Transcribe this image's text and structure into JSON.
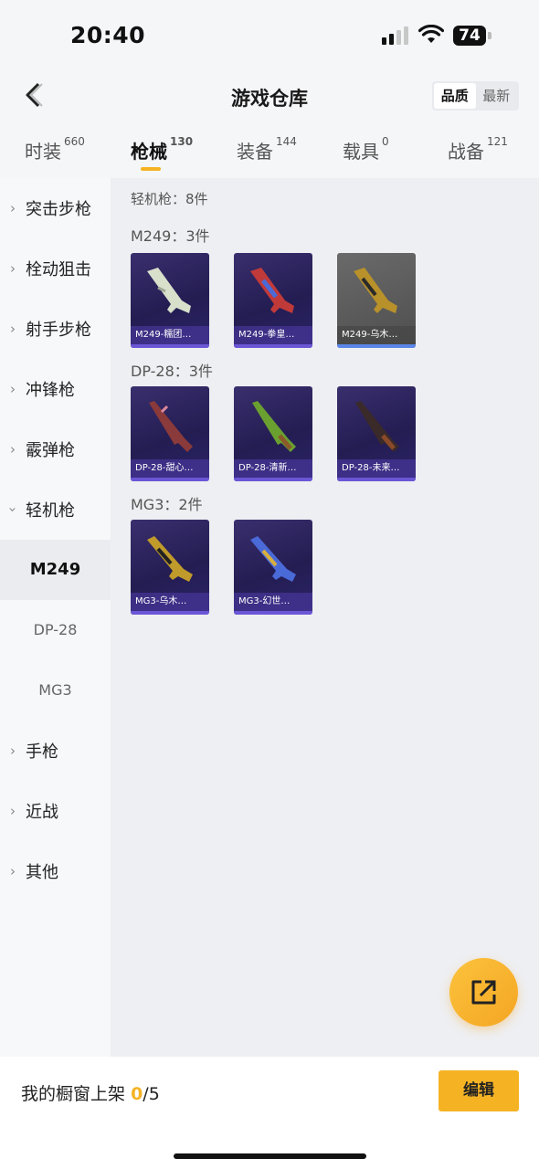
{
  "status": {
    "time": "20:40",
    "battery": "74"
  },
  "nav": {
    "title": "游戏仓库",
    "sort_options": [
      "品质",
      "最新"
    ]
  },
  "tabs": [
    {
      "label": "时装",
      "count": "660"
    },
    {
      "label": "枪械",
      "count": "130"
    },
    {
      "label": "装备",
      "count": "144"
    },
    {
      "label": "载具",
      "count": "0"
    },
    {
      "label": "战备",
      "count": "121"
    }
  ],
  "sidebar": {
    "categories": [
      "突击步枪",
      "栓动狙击",
      "射手步枪",
      "冲锋枪",
      "霰弹枪",
      "轻机枪",
      "手枪",
      "近战",
      "其他"
    ],
    "subs": [
      "M249",
      "DP-28",
      "MG3"
    ]
  },
  "content": {
    "total": "轻机枪：8件",
    "groups": [
      {
        "title": "M249：3件",
        "items": [
          "M249-糯团…",
          "M249-拳皇…",
          "M249-乌木…"
        ]
      },
      {
        "title": "DP-28：3件",
        "items": [
          "DP-28-甜心…",
          "DP-28-清新…",
          "DP-28-未来…"
        ]
      },
      {
        "title": "MG3：2件",
        "items": [
          "MG3-乌木…",
          "MG3-幻世…"
        ]
      }
    ]
  },
  "bottom": {
    "shelf_label": "我的橱窗上架",
    "shelf_used": "0",
    "shelf_total": "/5",
    "edit": "编辑"
  },
  "colors": {
    "accent": "#f5b324",
    "card_bg": "#2a2468"
  }
}
